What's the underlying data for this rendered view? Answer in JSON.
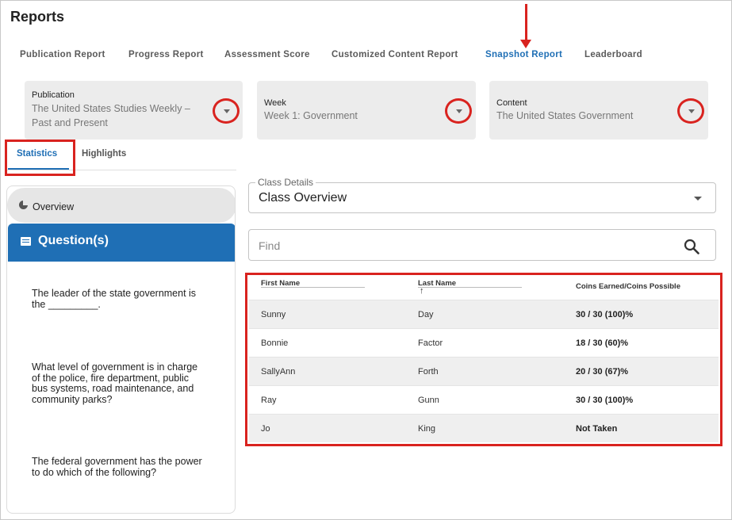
{
  "app": {
    "title": "Reports"
  },
  "report_tabs": [
    {
      "label": "Publication Report",
      "active": false
    },
    {
      "label": "Progress Report",
      "active": false
    },
    {
      "label": "Assessment Score",
      "active": false
    },
    {
      "label": "Customized Content Report",
      "active": false
    },
    {
      "label": "Snapshot Report",
      "active": true
    },
    {
      "label": "Leaderboard",
      "active": false
    }
  ],
  "filters": {
    "publication": {
      "label": "Publication",
      "value_line1": "The United States Studies Weekly –",
      "value_line2": "Past and Present"
    },
    "week": {
      "label": "Week",
      "value": "Week 1: Government"
    },
    "content": {
      "label": "Content",
      "value": "The United States Government"
    }
  },
  "sub_tabs": {
    "statistics": "Statistics",
    "highlights": "Highlights"
  },
  "sidebar": {
    "overview_label": "Overview",
    "questions_title": "Question(s)",
    "questions": [
      {
        "line1": "The leader of the state government is",
        "line2": "the _________."
      },
      {
        "line1": "What level of government is in charge",
        "line2": "of the police, fire department, public",
        "line3": "bus systems, road maintenance, and",
        "line4": "community parks?"
      },
      {
        "line1": "The federal government has the power",
        "line2": "to do which of the following?"
      }
    ]
  },
  "class_details": {
    "legend": "Class Details",
    "value": "Class Overview"
  },
  "search": {
    "placeholder": "Find"
  },
  "table": {
    "headers": {
      "first_name": "First Name",
      "last_name": "Last Name",
      "coins": "Coins Earned/Coins Possible",
      "sort_indicator": "↑"
    },
    "rows": [
      {
        "first": "Sunny",
        "last": "Day",
        "coins": "30 / 30 (100)%"
      },
      {
        "first": "Bonnie",
        "last": "Factor",
        "coins": "18 / 30 (60)%"
      },
      {
        "first": "SallyAnn",
        "last": "Forth",
        "coins": "20 / 30 (67)%"
      },
      {
        "first": "Ray",
        "last": "Gunn",
        "coins": "30 / 30 (100)%"
      },
      {
        "first": "Jo",
        "last": "King",
        "coins": "Not Taken"
      }
    ]
  },
  "colors": {
    "accent": "#1f6fb5",
    "highlight": "#d9231f",
    "filter_bg": "#ececec"
  }
}
